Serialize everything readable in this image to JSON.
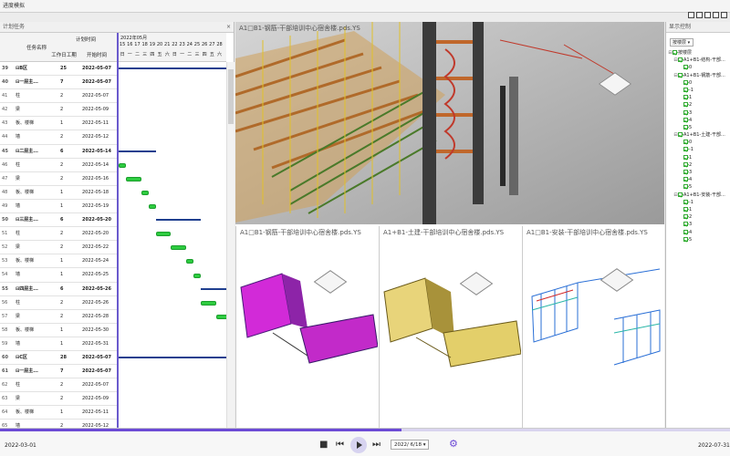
{
  "window": {
    "title": "进度模拟"
  },
  "left_panel": {
    "title": "计划任务",
    "close": "×",
    "headers": {
      "name": "任务名称",
      "plan_time": "计划时间",
      "duration": "工作日工期",
      "start": "开始时间"
    },
    "rows": [
      {
        "id": "39",
        "name": "⊟B区",
        "dur": "25",
        "start": "2022-05-07",
        "summary": true
      },
      {
        "id": "40",
        "name": "⊟一层主...",
        "dur": "7",
        "start": "2022-05-07",
        "summary": true
      },
      {
        "id": "41",
        "name": "柱",
        "dur": "2",
        "start": "2022-05-07",
        "summary": false
      },
      {
        "id": "42",
        "name": "梁",
        "dur": "2",
        "start": "2022-05-09",
        "summary": false
      },
      {
        "id": "43",
        "name": "板、楼梯",
        "dur": "1",
        "start": "2022-05-11",
        "summary": false
      },
      {
        "id": "44",
        "name": "墙",
        "dur": "2",
        "start": "2022-05-12",
        "summary": false
      },
      {
        "id": "45",
        "name": "⊟二层主...",
        "dur": "6",
        "start": "2022-05-14",
        "summary": true
      },
      {
        "id": "46",
        "name": "柱",
        "dur": "2",
        "start": "2022-05-14",
        "summary": false
      },
      {
        "id": "47",
        "name": "梁",
        "dur": "2",
        "start": "2022-05-16",
        "summary": false
      },
      {
        "id": "48",
        "name": "板、楼梯",
        "dur": "1",
        "start": "2022-05-18",
        "summary": false
      },
      {
        "id": "49",
        "name": "墙",
        "dur": "1",
        "start": "2022-05-19",
        "summary": false
      },
      {
        "id": "50",
        "name": "⊟三层主...",
        "dur": "6",
        "start": "2022-05-20",
        "summary": true
      },
      {
        "id": "51",
        "name": "柱",
        "dur": "2",
        "start": "2022-05-20",
        "summary": false
      },
      {
        "id": "52",
        "name": "梁",
        "dur": "2",
        "start": "2022-05-22",
        "summary": false
      },
      {
        "id": "53",
        "name": "板、楼梯",
        "dur": "1",
        "start": "2022-05-24",
        "summary": false
      },
      {
        "id": "54",
        "name": "墙",
        "dur": "1",
        "start": "2022-05-25",
        "summary": false
      },
      {
        "id": "55",
        "name": "⊟四层主...",
        "dur": "6",
        "start": "2022-05-26",
        "summary": true
      },
      {
        "id": "56",
        "name": "柱",
        "dur": "2",
        "start": "2022-05-26",
        "summary": false
      },
      {
        "id": "57",
        "name": "梁",
        "dur": "2",
        "start": "2022-05-28",
        "summary": false
      },
      {
        "id": "58",
        "name": "板、楼梯",
        "dur": "1",
        "start": "2022-05-30",
        "summary": false
      },
      {
        "id": "59",
        "name": "墙",
        "dur": "1",
        "start": "2022-05-31",
        "summary": false
      },
      {
        "id": "60",
        "name": "⊟C区",
        "dur": "28",
        "start": "2022-05-07",
        "summary": true
      },
      {
        "id": "61",
        "name": "⊟一层主...",
        "dur": "7",
        "start": "2022-05-07",
        "summary": true
      },
      {
        "id": "62",
        "name": "柱",
        "dur": "2",
        "start": "2022-05-07",
        "summary": false
      },
      {
        "id": "63",
        "name": "梁",
        "dur": "2",
        "start": "2022-05-09",
        "summary": false
      },
      {
        "id": "64",
        "name": "板、楼梯",
        "dur": "1",
        "start": "2022-05-11",
        "summary": false
      },
      {
        "id": "65",
        "name": "墙",
        "dur": "2",
        "start": "2022-05-12",
        "summary": false
      }
    ]
  },
  "gantt": {
    "month": "2022年05月",
    "days": [
      "15",
      "16",
      "17",
      "18",
      "19",
      "20",
      "21",
      "22",
      "23",
      "24",
      "25",
      "26",
      "27",
      "28"
    ],
    "weekdays": [
      "日",
      "一",
      "二",
      "三",
      "四",
      "五",
      "六",
      "日",
      "一",
      "二",
      "三",
      "四",
      "五",
      "六"
    ]
  },
  "viewports": {
    "main": "A1□B1-钢筋-干部培训中心宿舍楼.pds.YS",
    "v1": "A1□B1-钢筋-干部培训中心宿舍楼.pds.YS",
    "v2": "A1+B1-土建-干部培训中心宿舍楼.pds.YS",
    "v3": "A1□B1-安装-干部培训中心宿舍楼.pds.YS"
  },
  "right_panel": {
    "title": "显示控制",
    "dropdown": "按楼层",
    "tree": [
      {
        "t": "⊟",
        "label": "按楼层",
        "lvl": 0
      },
      {
        "t": "⊟",
        "label": "A1+B1-结构-干部...",
        "lvl": 1
      },
      {
        "t": "",
        "label": "0",
        "lvl": 2
      },
      {
        "t": "⊟",
        "label": "A1+B1-钢筋-干部...",
        "lvl": 1
      },
      {
        "t": "",
        "label": "0",
        "lvl": 2
      },
      {
        "t": "",
        "label": "-1",
        "lvl": 2
      },
      {
        "t": "",
        "label": "1",
        "lvl": 2
      },
      {
        "t": "",
        "label": "2",
        "lvl": 2
      },
      {
        "t": "",
        "label": "3",
        "lvl": 2
      },
      {
        "t": "",
        "label": "4",
        "lvl": 2
      },
      {
        "t": "",
        "label": "5",
        "lvl": 2
      },
      {
        "t": "⊟",
        "label": "A1+B1-土建-干部...",
        "lvl": 1
      },
      {
        "t": "",
        "label": "0",
        "lvl": 2
      },
      {
        "t": "",
        "label": "-1",
        "lvl": 2
      },
      {
        "t": "",
        "label": "1",
        "lvl": 2
      },
      {
        "t": "",
        "label": "2",
        "lvl": 2
      },
      {
        "t": "",
        "label": "3",
        "lvl": 2
      },
      {
        "t": "",
        "label": "4",
        "lvl": 2
      },
      {
        "t": "",
        "label": "5",
        "lvl": 2
      },
      {
        "t": "⊟",
        "label": "A1+B1-安装-干部...",
        "lvl": 1
      },
      {
        "t": "",
        "label": "-1",
        "lvl": 2
      },
      {
        "t": "",
        "label": "1",
        "lvl": 2
      },
      {
        "t": "",
        "label": "2",
        "lvl": 2
      },
      {
        "t": "",
        "label": "3",
        "lvl": 2
      },
      {
        "t": "",
        "label": "4",
        "lvl": 2
      },
      {
        "t": "",
        "label": "5",
        "lvl": 2
      }
    ]
  },
  "playback": {
    "start_date": "2022-03-01",
    "end_date": "2022-07-31",
    "current_date": "2022/ 6/18",
    "progress": 0.55,
    "stop": "■",
    "prev": "⏮",
    "next": "⏭",
    "gear": "⚙"
  },
  "colors": {
    "accent": "#6c4ad6",
    "gantt_bar": "#2ecc40",
    "summary_bar": "#1f3f8f"
  }
}
